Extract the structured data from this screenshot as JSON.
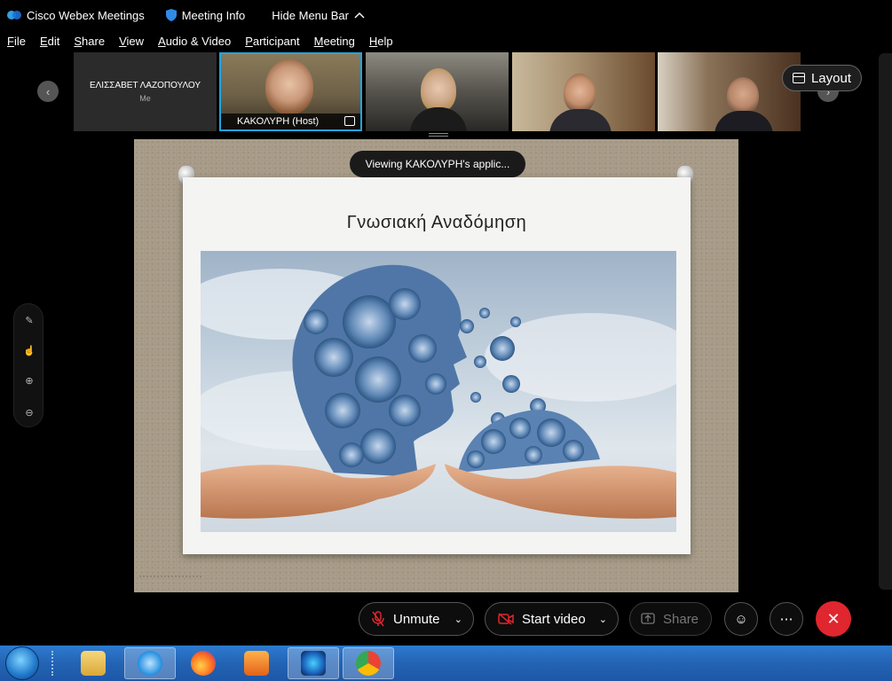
{
  "titlebar": {
    "app_title": "Cisco Webex Meetings",
    "meeting_info": "Meeting Info",
    "hide_menu": "Hide Menu Bar"
  },
  "menu": [
    "File",
    "Edit",
    "Share",
    "View",
    "Audio & Video",
    "Participant",
    "Meeting",
    "Help"
  ],
  "participants": {
    "self_name": "ΕΛΙΣΣΑΒΕΤ ΛΑΖΟΠΟΥΛΟΥ",
    "self_tag": "Me",
    "host_label": "ΚΑΚΟΛΥΡΗ  (Host)"
  },
  "layout_button": "Layout",
  "share": {
    "viewing_text": "Viewing ΚΑΚΟΛΥΡΗ's applic...",
    "slide_title": "Γνωσιακή Αναδόμηση"
  },
  "controls": {
    "unmute": "Unmute",
    "start_video": "Start video",
    "share": "Share"
  },
  "colors": {
    "end_button": "#e0262f",
    "host_border": "#1fa5e0",
    "taskbar": "#2463b4"
  }
}
